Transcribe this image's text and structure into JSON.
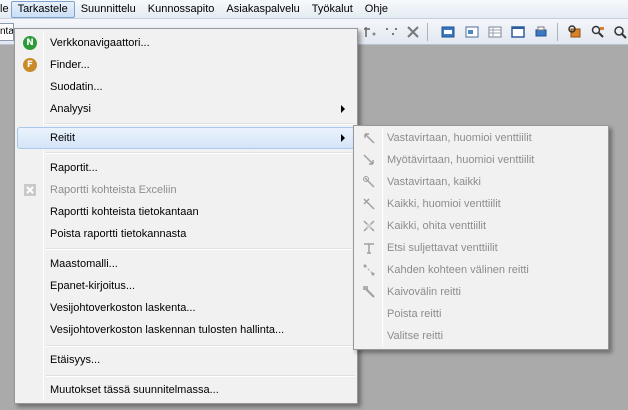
{
  "menubar": {
    "items": [
      {
        "label": "le"
      },
      {
        "label": "Tarkastele"
      },
      {
        "label": "Suunnittelu"
      },
      {
        "label": "Kunnossapito"
      },
      {
        "label": "Asiakaspalvelu"
      },
      {
        "label": "Työkalut"
      },
      {
        "label": "Ohje"
      }
    ]
  },
  "toolbar": {
    "combo_text": "nta"
  },
  "menu": {
    "items": [
      {
        "label": "Verkkonavigaattori...",
        "icon": "n-badge-icon"
      },
      {
        "label": "Finder...",
        "icon": "f-badge-icon"
      },
      {
        "label": "Suodatin..."
      },
      {
        "label": "Analyysi",
        "submenu": true
      },
      {
        "label": "Reitit",
        "submenu": true
      },
      {
        "label": "Raportit..."
      },
      {
        "label": "Raportti kohteista Exceliin",
        "icon": "excel-icon"
      },
      {
        "label": "Raportti kohteista tietokantaan"
      },
      {
        "label": "Poista raportti tietokannasta"
      },
      {
        "label": "Maastomalli..."
      },
      {
        "label": "Epanet-kirjoitus..."
      },
      {
        "label": "Vesijohtoverkoston laskenta..."
      },
      {
        "label": "Vesijohtoverkoston laskennan tulosten hallinta..."
      },
      {
        "label": "Etäisyys..."
      },
      {
        "label": "Muutokset tässä suunnitelmassa..."
      }
    ]
  },
  "submenu": {
    "items": [
      {
        "label": "Vastavirtaan, huomioi venttiilit"
      },
      {
        "label": "Myötävirtaan, huomioi venttiilit"
      },
      {
        "label": "Vastavirtaan, kaikki"
      },
      {
        "label": "Kaikki, huomioi venttiilit"
      },
      {
        "label": "Kaikki, ohita venttiilit"
      },
      {
        "label": "Etsi suljettavat venttiilit"
      },
      {
        "label": "Kahden kohteen välinen reitti"
      },
      {
        "label": "Kaivovälin reitti"
      },
      {
        "label": "Poista reitti"
      },
      {
        "label": "Valitse reitti"
      }
    ]
  },
  "colors": {
    "badge_n": "#2e9b3b",
    "badge_f": "#c98a27",
    "highlight_border": "#a8c8ec",
    "disabled_text": "#8d8d8d"
  }
}
